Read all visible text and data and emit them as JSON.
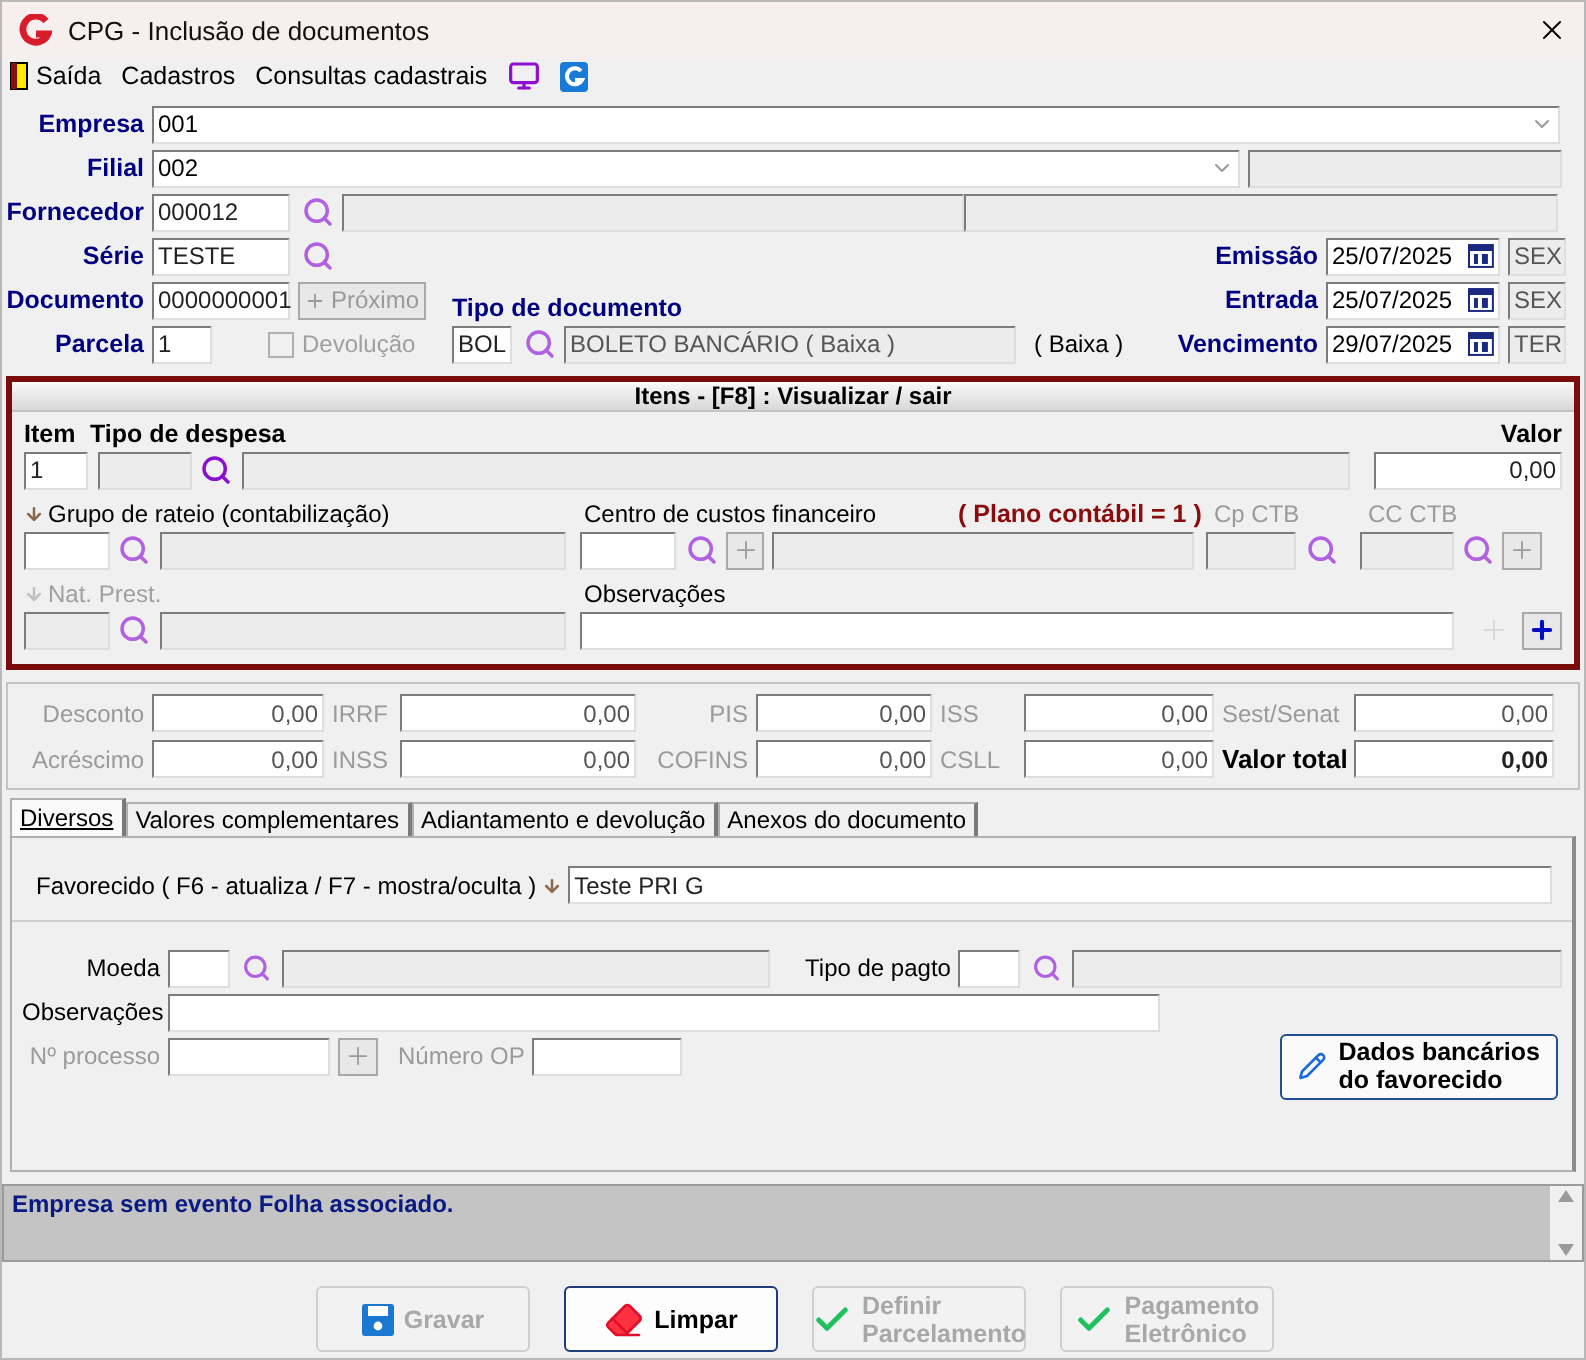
{
  "window": {
    "title": "CPG - Inclusão de documentos"
  },
  "menu": [
    {
      "label": "Saída",
      "kind": "exit"
    },
    {
      "label": "Cadastros",
      "kind": "text"
    },
    {
      "label": "Consultas cadastrais",
      "kind": "text"
    }
  ],
  "header": {
    "empresa": {
      "label": "Empresa",
      "code": "001"
    },
    "filial": {
      "label": "Filial",
      "code": "002"
    },
    "fornecedor": {
      "label": "Fornecedor",
      "code": "000012"
    },
    "serie": {
      "label": "Série",
      "value": "TESTE"
    },
    "documento": {
      "label": "Documento",
      "value": "0000000001",
      "next_label": "Próximo",
      "next_disabled": true
    },
    "parcela": {
      "label": "Parcela",
      "value": "1"
    },
    "devolucao": {
      "label": "Devolução",
      "checked": false,
      "disabled": true
    },
    "tipo_documento": {
      "label": "Tipo de documento",
      "code": "BOL",
      "description": "BOLETO BANCÁRIO ( Baixa )",
      "note": "( Baixa )"
    },
    "dates": [
      {
        "label": "Emissão",
        "value": "25/07/2025",
        "weekday": "SEX"
      },
      {
        "label": "Entrada",
        "value": "25/07/2025",
        "weekday": "SEX"
      },
      {
        "label": "Vencimento",
        "value": "29/07/2025",
        "weekday": "TER"
      }
    ]
  },
  "items": {
    "title": "Itens  - [F8] : Visualizar / sair",
    "item_label": "Item",
    "item_value": "1",
    "tipo_label": "Tipo de despesa",
    "valor_label": "Valor",
    "valor": "0,00",
    "grupo_label": "Grupo de rateio (contabilização)",
    "centro_label": "Centro de custos financeiro",
    "plano": "( Plano contábil = 1 )",
    "cp_ctb": {
      "label": "Cp CTB",
      "disabled": true
    },
    "cc_ctb": {
      "label": "CC CTB",
      "disabled": true
    },
    "nat_prest": {
      "label": "Nat. Prest.",
      "disabled": true
    },
    "obs_label": "Observações"
  },
  "totals": [
    {
      "label": "Desconto",
      "value": "0,00",
      "kind": "tax"
    },
    {
      "label": "IRRF",
      "value": "0,00",
      "kind": "tax"
    },
    {
      "label": "PIS",
      "value": "0,00",
      "kind": "tax"
    },
    {
      "label": "ISS",
      "value": "0,00",
      "kind": "tax"
    },
    {
      "label": "Sest/Senat",
      "value": "0,00",
      "kind": "tax"
    },
    {
      "label": "Acréscimo",
      "value": "0,00",
      "kind": "tax"
    },
    {
      "label": "INSS",
      "value": "0,00",
      "kind": "tax"
    },
    {
      "label": "COFINS",
      "value": "0,00",
      "kind": "tax"
    },
    {
      "label": "CSLL",
      "value": "0,00",
      "kind": "tax"
    },
    {
      "label": "Valor total",
      "value": "0,00",
      "kind": "total"
    }
  ],
  "tabs": [
    {
      "label": "Diversos",
      "selected": true
    },
    {
      "label": "Valores complementares",
      "selected": false
    },
    {
      "label": "Adiantamento e devolução",
      "selected": false
    },
    {
      "label": "Anexos do documento",
      "selected": false
    }
  ],
  "diversos": {
    "favorecido_label": "Favorecido ( F6 - atualiza / F7 - mostra/oculta )",
    "favorecido": "Teste PRI G",
    "moeda_label": "Moeda",
    "tipo_pagto_label": "Tipo de pagto",
    "obs_label": "Observações",
    "processo": {
      "label": "Nº processo",
      "disabled": true
    },
    "numero_op": {
      "label": "Número OP",
      "disabled": true
    },
    "bank_button": [
      "Dados bancários",
      "do favorecido"
    ]
  },
  "status": "Empresa sem evento Folha associado.",
  "buttons": [
    {
      "lines": [
        "Gravar"
      ],
      "kind": "save",
      "disabled": true
    },
    {
      "lines": [
        "Limpar"
      ],
      "kind": "eraser",
      "disabled": false
    },
    {
      "lines": [
        "Definir",
        "Parcelamento"
      ],
      "kind": "check",
      "disabled": true
    },
    {
      "lines": [
        "Pagamento",
        "Eletrônico"
      ],
      "kind": "check",
      "disabled": true
    }
  ]
}
